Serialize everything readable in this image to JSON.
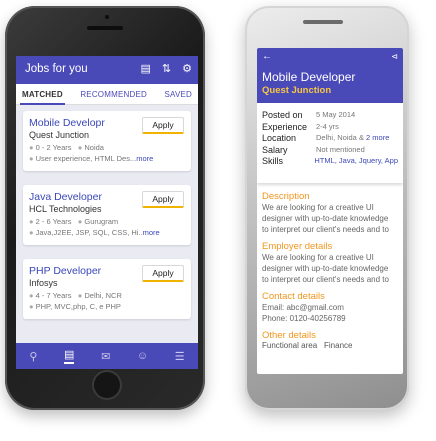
{
  "phone1": {
    "header": {
      "title": "Jobs for you",
      "icons": [
        "clipboard-icon",
        "sort-icon",
        "bell-settings-icon"
      ]
    },
    "tabs": [
      {
        "label": "MATCHED",
        "active": true
      },
      {
        "label": "RECOMMENDED",
        "active": false
      },
      {
        "label": "SAVED",
        "active": false
      }
    ],
    "jobs": [
      {
        "title": "Mobile Developr",
        "company": "Quest Junction",
        "experience": "0 - 2 Years",
        "location": "Noida",
        "skills": "User experience, HTML Des...",
        "more": "more",
        "apply": "Apply"
      },
      {
        "title": "Java Developer",
        "company": "HCL Technologies",
        "experience": "2 - 6 Years",
        "location": "Gurugram",
        "skills": "Java,J2EE, JSP, SQL, CSS, Hi..",
        "more": "more",
        "apply": "Apply"
      },
      {
        "title": "PHP Developer",
        "company": "Infosys",
        "experience": "4 - 7 Years",
        "location": "Delhi, NCR",
        "skills": "PHP, MVC,php, C, e PHP",
        "more": "",
        "apply": "Apply"
      }
    ],
    "bottom_nav": [
      "search-icon",
      "jobs-icon",
      "mail-icon",
      "profile-icon",
      "menu-icon"
    ],
    "accent": "#4a49b8"
  },
  "phone2": {
    "header": {
      "title": "Mobile Developer",
      "company": "Quest Junction"
    },
    "info": [
      {
        "key": "Posted on",
        "value": "5 May 2014"
      },
      {
        "key": "Experience",
        "value": "2-4 yrs"
      },
      {
        "key": "Location",
        "value": "Delhi, Noida & ",
        "link": "2 more"
      },
      {
        "key": "Salary",
        "value": "Not mentioned"
      },
      {
        "key": "Skills",
        "value": "",
        "link": "HTML, Java, Jquery, App"
      }
    ],
    "sections": {
      "description_title": "Description",
      "description_l1": "We are looking for a creative UI",
      "description_l2": "designer with up-to-date knowledge",
      "description_l3": "to interpret our client's needs and to",
      "employer_title": "Employer details",
      "employer_l1": "We are looking for a creative UI",
      "employer_l2": "designer with up-to-date knowledge",
      "employer_l3": "to interpret our client's needs and to",
      "contact_title": "Contact details",
      "contact_email": "Email: abc@gmail.com",
      "contact_phone": "Phone: 0120-40256789",
      "other_title": "Other details",
      "functional_key": "Functional area",
      "functional_val": "Finance"
    },
    "accent_orange": "#f0961e"
  }
}
